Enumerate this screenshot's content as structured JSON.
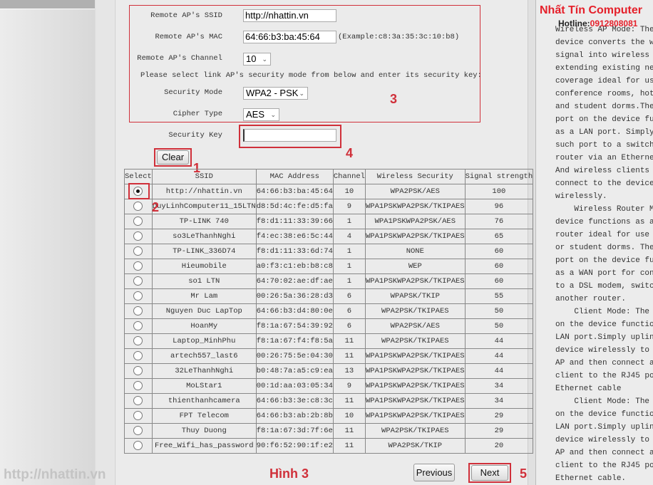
{
  "form": {
    "ssid_label": "Remote AP's SSID",
    "ssid_value": "http://nhattin.vn",
    "mac_label": "Remote AP's MAC",
    "mac_value": "64:66:b3:ba:45:64",
    "mac_example": "(Example:c8:3a:35:3c:10:b8)",
    "channel_label": "Remote AP's Channel",
    "channel_value": "10",
    "instruction": "Please select link AP's security mode from below and enter its security key:",
    "security_mode_label": "Security Mode",
    "security_mode_value": "WPA2 - PSK",
    "cipher_label": "Cipher Type",
    "cipher_value": "AES",
    "key_label": "Security Key",
    "key_value": "",
    "clear_label": "Clear"
  },
  "table": {
    "headers": [
      "Select",
      "SSID",
      "MAC Address",
      "Channel",
      "Wireless Security",
      "Signal strength"
    ],
    "rows": [
      {
        "selected": true,
        "ssid": "http://nhattin.vn",
        "mac": "64:66:b3:ba:45:64",
        "channel": "10",
        "security": "WPA2PSK/AES",
        "signal": "100"
      },
      {
        "selected": false,
        "ssid": "DuyLinhComputer11_15LTN",
        "mac": "d8:5d:4c:fe:d5:fa",
        "channel": "9",
        "security": "WPA1PSKWPA2PSK/TKIPAES",
        "signal": "96"
      },
      {
        "selected": false,
        "ssid": "TP-LINK 740",
        "mac": "f8:d1:11:33:39:66",
        "channel": "1",
        "security": "WPA1PSKWPA2PSK/AES",
        "signal": "76"
      },
      {
        "selected": false,
        "ssid": "so3LeThanhNghi",
        "mac": "f4:ec:38:e6:5c:44",
        "channel": "4",
        "security": "WPA1PSKWPA2PSK/TKIPAES",
        "signal": "65"
      },
      {
        "selected": false,
        "ssid": "TP-LINK_336D74",
        "mac": "f8:d1:11:33:6d:74",
        "channel": "1",
        "security": "NONE",
        "signal": "60"
      },
      {
        "selected": false,
        "ssid": "Hieumobile",
        "mac": "a0:f3:c1:eb:b8:c8",
        "channel": "1",
        "security": "WEP",
        "signal": "60"
      },
      {
        "selected": false,
        "ssid": "so1 LTN",
        "mac": "64:70:02:ae:df:ae",
        "channel": "1",
        "security": "WPA1PSKWPA2PSK/TKIPAES",
        "signal": "60"
      },
      {
        "selected": false,
        "ssid": "Mr Lam",
        "mac": "00:26:5a:36:28:d3",
        "channel": "6",
        "security": "WPAPSK/TKIP",
        "signal": "55"
      },
      {
        "selected": false,
        "ssid": "Nguyen Duc LapTop",
        "mac": "64:66:b3:d4:80:0e",
        "channel": "6",
        "security": "WPA2PSK/TKIPAES",
        "signal": "50"
      },
      {
        "selected": false,
        "ssid": "HoanMy",
        "mac": "f8:1a:67:54:39:92",
        "channel": "6",
        "security": "WPA2PSK/AES",
        "signal": "50"
      },
      {
        "selected": false,
        "ssid": "Laptop_MinhPhu",
        "mac": "f8:1a:67:f4:f8:5a",
        "channel": "11",
        "security": "WPA2PSK/TKIPAES",
        "signal": "44"
      },
      {
        "selected": false,
        "ssid": "artech557_last6",
        "mac": "00:26:75:5e:04:30",
        "channel": "11",
        "security": "WPA1PSKWPA2PSK/TKIPAES",
        "signal": "44"
      },
      {
        "selected": false,
        "ssid": "32LeThanhNghi",
        "mac": "b0:48:7a:a5:c9:ea",
        "channel": "13",
        "security": "WPA1PSKWPA2PSK/TKIPAES",
        "signal": "44"
      },
      {
        "selected": false,
        "ssid": "MoLStar1",
        "mac": "00:1d:aa:03:05:34",
        "channel": "9",
        "security": "WPA1PSKWPA2PSK/TKIPAES",
        "signal": "34"
      },
      {
        "selected": false,
        "ssid": "thienthanhcamera",
        "mac": "64:66:b3:3e:c8:3c",
        "channel": "11",
        "security": "WPA1PSKWPA2PSK/TKIPAES",
        "signal": "34"
      },
      {
        "selected": false,
        "ssid": "FPT Telecom",
        "mac": "64:66:b3:ab:2b:8b",
        "channel": "10",
        "security": "WPA1PSKWPA2PSK/TKIPAES",
        "signal": "29"
      },
      {
        "selected": false,
        "ssid": "Thuy Duong",
        "mac": "f8:1a:67:3d:7f:6e",
        "channel": "11",
        "security": "WPA2PSK/TKIPAES",
        "signal": "29"
      },
      {
        "selected": false,
        "ssid": "Free_Wifi_has_password",
        "mac": "90:f6:52:90:1f:e2",
        "channel": "11",
        "security": "WPA2PSK/TKIP",
        "signal": "20"
      }
    ]
  },
  "nav": {
    "previous_label": "Previous",
    "next_label": "Next"
  },
  "annotations": {
    "n1": "1",
    "n2": "2",
    "n3": "3",
    "n4": "4",
    "n5": "5",
    "caption": "Hình 3",
    "watermark": "http://nhattin.vn",
    "brand": "Nhất Tín Computer",
    "hotline_label": "Hotline:",
    "hotline_number": "0912808081"
  },
  "help_text": "Wireless AP Mode: The\ndevice converts the wir\nsignal into wireless si\nextending existing netw\ncoverage ideal for use\nconference rooms, hotel\nand student dorms.The R\nport on the device func\nas a LAN port. Simply u\nsuch port to a switch o\nrouter via an Ethernet\nAnd wireless clients ca\nconnect to the device\nwirelessly.\n    Wireless Router Mod\ndevice functions as a w\nrouter ideal for use at\nor student dorms. The R\nport on the device func\nas a WAN port for conne\nto a DSL modem, switch\nanother router.\n    Client Mode: The RJ\non the device functions\nLAN port.Simply uplink\ndevice wirelessly to a\nAP and then connect a w\nclient to the RJ45 port\nEthernet cable\n    Client Mode: The RJ\non the device functions\nLAN port.Simply uplink\ndevice wirelessly to a\nAP and then connect a w\nclient to the RJ45 port\nEthernet cable.\n    Universal Repeater",
  "colors": {
    "annotation_red": "#d0303a",
    "brand_red": "#e5202a",
    "brand_black": "#222222"
  }
}
